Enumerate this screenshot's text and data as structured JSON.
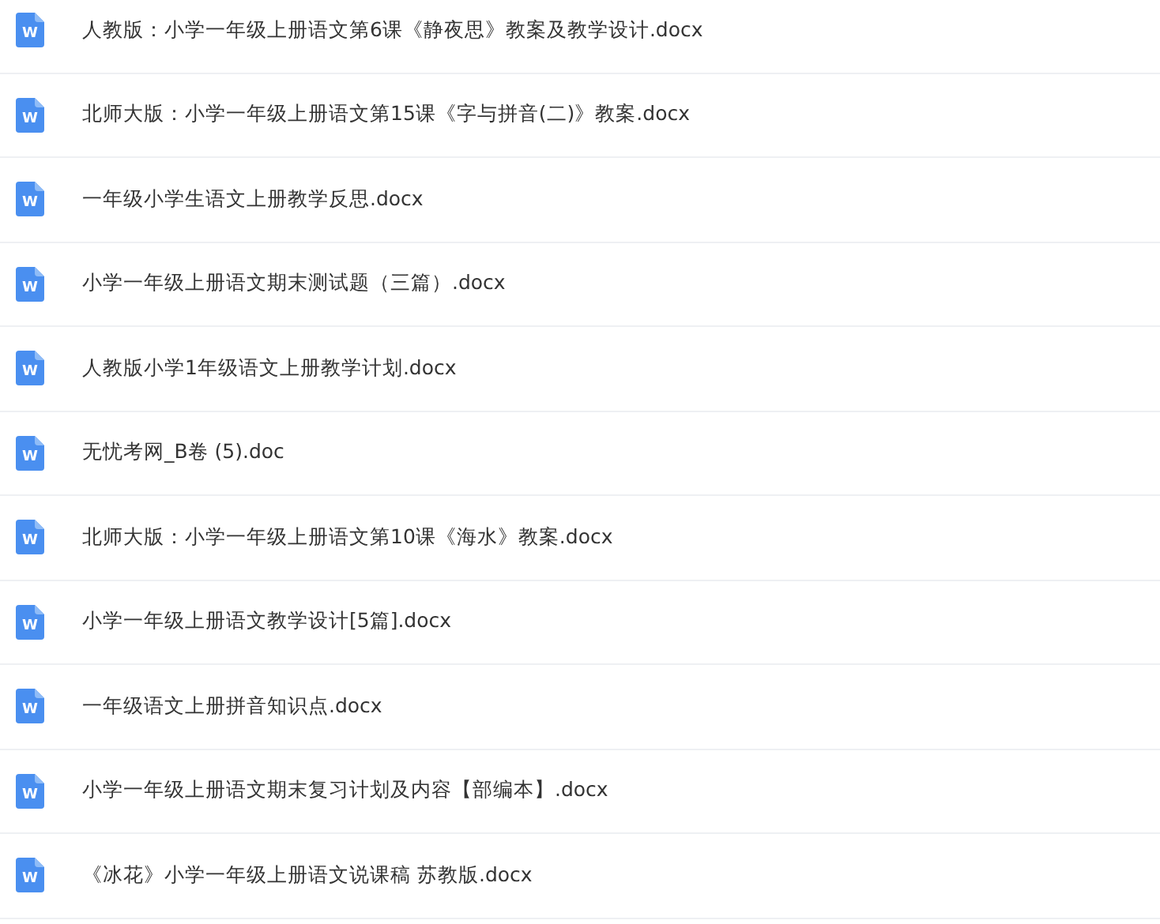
{
  "files": [
    {
      "icon": "W",
      "name": "人教版：小学一年级上册语文第6课《静夜思》教案及教学设计.docx"
    },
    {
      "icon": "W",
      "name": "北师大版：小学一年级上册语文第15课《字与拼音(二)》教案.docx"
    },
    {
      "icon": "W",
      "name": "一年级小学生语文上册教学反思.docx"
    },
    {
      "icon": "W",
      "name": "小学一年级上册语文期末测试题（三篇）.docx"
    },
    {
      "icon": "W",
      "name": "人教版小学1年级语文上册教学计划.docx"
    },
    {
      "icon": "W",
      "name": "无忧考网_B卷 (5).doc"
    },
    {
      "icon": "W",
      "name": "北师大版：小学一年级上册语文第10课《海水》教案.docx"
    },
    {
      "icon": "W",
      "name": "小学一年级上册语文教学设计[5篇].docx"
    },
    {
      "icon": "W",
      "name": "一年级语文上册拼音知识点.docx"
    },
    {
      "icon": "W",
      "name": "小学一年级上册语文期末复习计划及内容【部编本】.docx"
    },
    {
      "icon": "W",
      "name": "《冰花》小学一年级上册语文说课稿 苏教版.docx"
    }
  ]
}
